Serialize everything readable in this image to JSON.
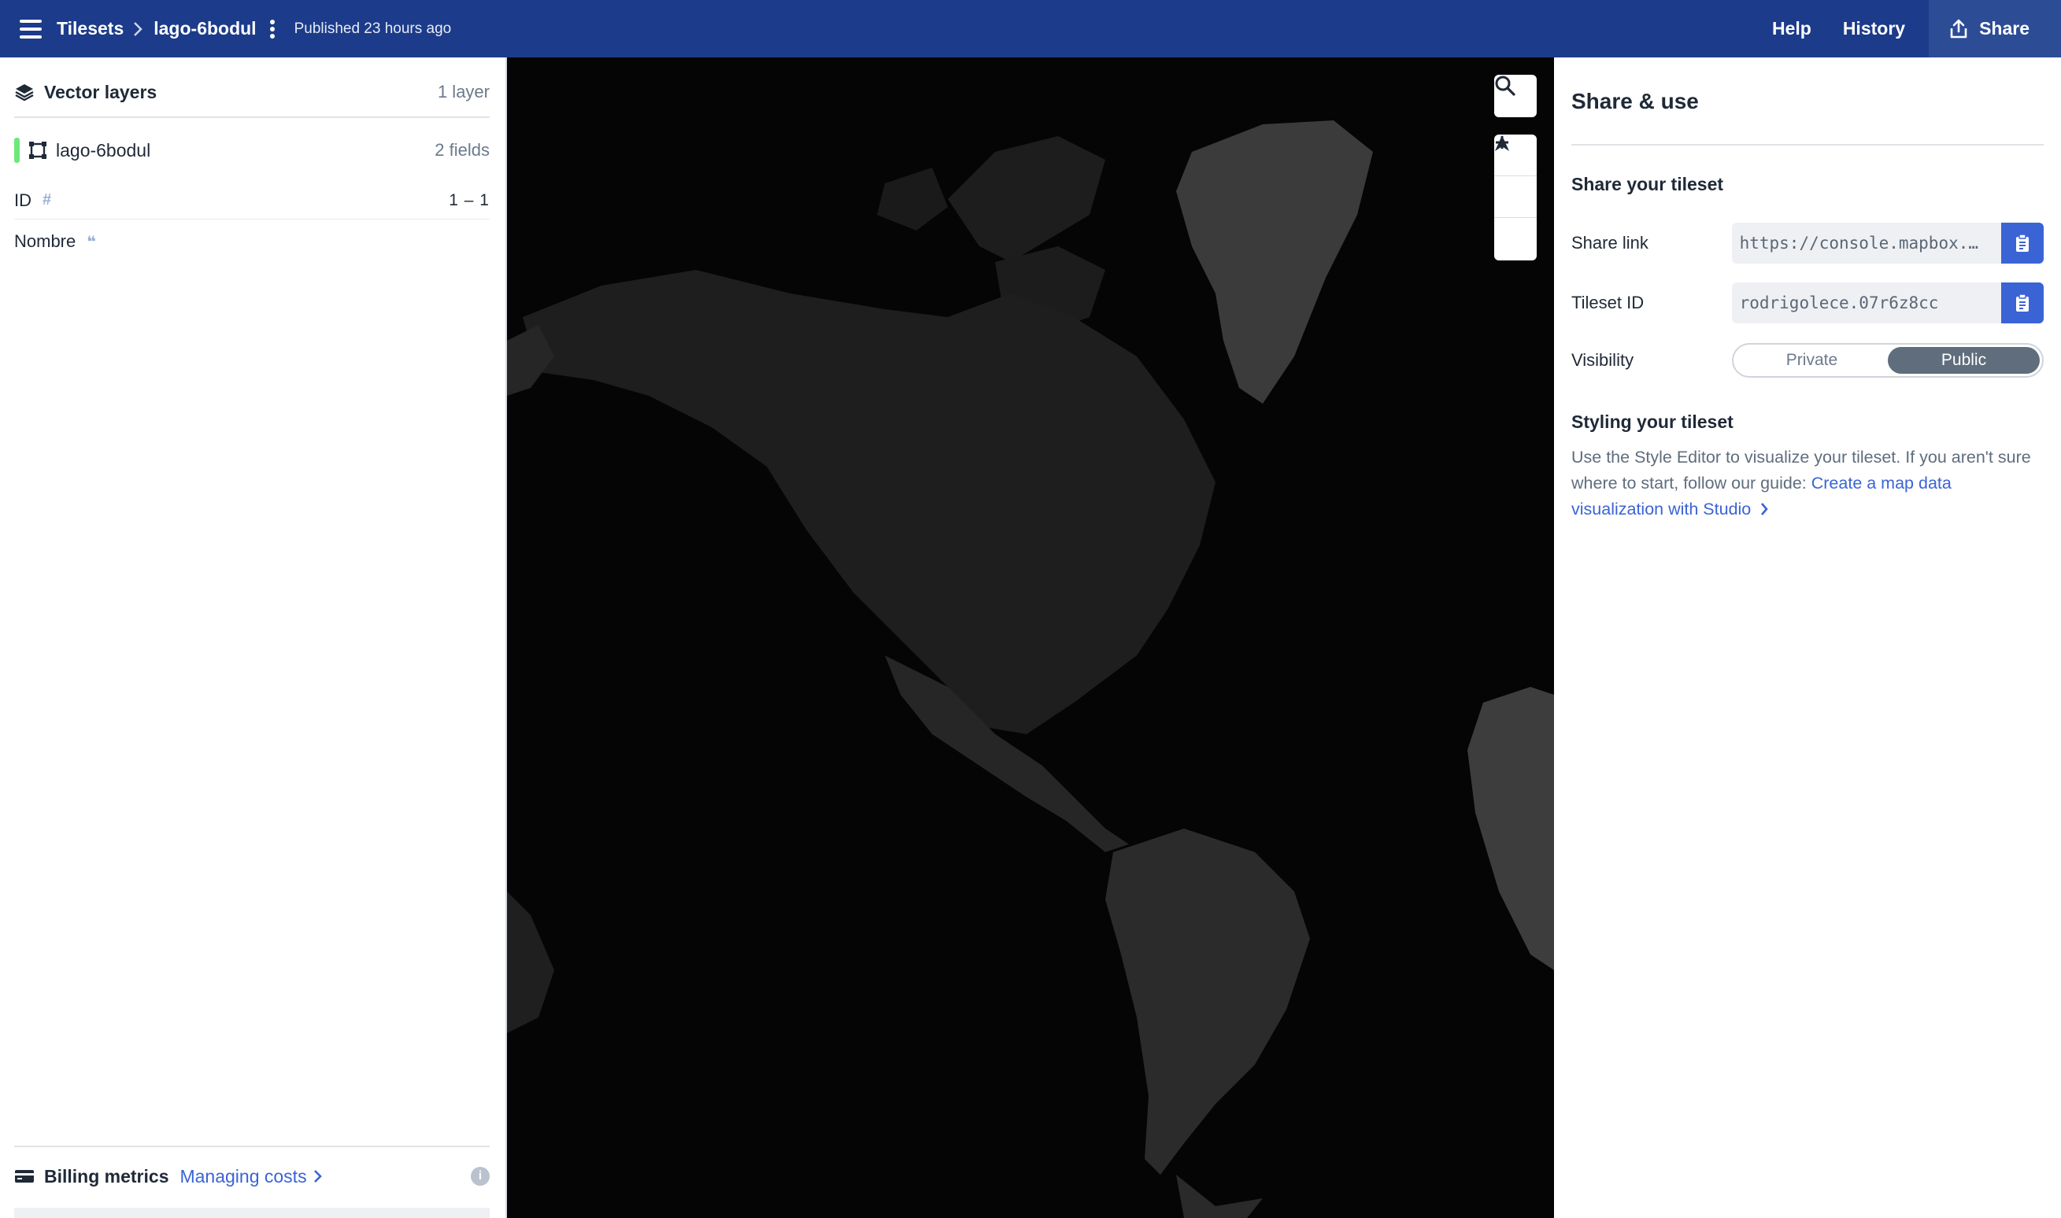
{
  "topbar": {
    "breadcrumb_root": "Tilesets",
    "breadcrumb_current": "lago-6bodul",
    "published": "Published 23 hours ago",
    "help": "Help",
    "history": "History",
    "share": "Share"
  },
  "left_panel": {
    "title": "Vector layers",
    "layer_count": "1 layer",
    "layer": {
      "name": "lago-6bodul",
      "fields": "2 fields",
      "color": "#6ee77a"
    },
    "field_rows": [
      {
        "name": "ID",
        "type_symbol": "#",
        "range": "1 – 1"
      },
      {
        "name": "Nombre",
        "type_symbol": "❝"
      }
    ],
    "billing": {
      "title": "Billing metrics",
      "link": "Managing costs",
      "info": "i"
    }
  },
  "map": {
    "controls": [
      "search-icon",
      "zoom-in-icon",
      "zoom-out-icon",
      "compass-icon"
    ],
    "land_color": "#3a3a3a",
    "water_color": "#050505"
  },
  "right_panel": {
    "title": "Share & use",
    "share_section": "Share your tileset",
    "share_link_label": "Share link",
    "share_link_value": "https://console.mapbox.…",
    "tileset_id_label": "Tileset ID",
    "tileset_id_value": "rodrigolece.07r6z8cc",
    "visibility_label": "Visibility",
    "visibility_options": [
      "Private",
      "Public"
    ],
    "visibility_selected": "Public",
    "styling_section": "Styling your tileset",
    "styling_text": "Use the Style Editor to visualize your tileset. If you aren't sure where to start, follow our guide: ",
    "styling_link": "Create a map data visualization with Studio"
  },
  "colors": {
    "topbar": "#1c3b8a",
    "accent": "#3a63d6"
  }
}
